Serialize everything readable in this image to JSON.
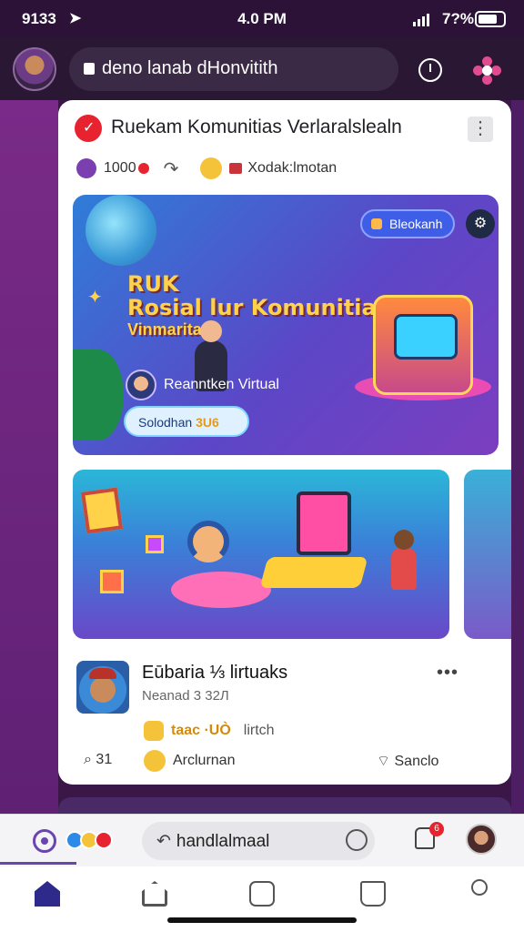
{
  "status_bar": {
    "time": "9133",
    "center_time": "4.0 PM",
    "battery": "7?%"
  },
  "browser": {
    "url": "deno lanab dHonvitith"
  },
  "card": {
    "title": "Ruekam Komunitias Verlaralslealn",
    "meta_count": "1000",
    "meta_label": "Xodak:lmotan",
    "hero": {
      "pill_label": "Bleokanh",
      "title_line1": "RUK",
      "title_line2": "Rosial lur Komunitias",
      "title_line3": "Vinmaritan",
      "badge_label": "Reanntken Virtual",
      "cta_prefix": "Solodhan ",
      "cta_accent": "3U6"
    },
    "post": {
      "title": "Eūbaria ⅓ lirtuaks",
      "subtitle": "Neanad 3 32Л",
      "tag_yellow": "taac ·UÒ",
      "tag_grey": "lirtch",
      "comments": "31",
      "reaction_label": "Arclurnan",
      "share_label": "Sanclo"
    }
  },
  "input_bar": {
    "placeholder_value": "handlalmaal",
    "notification_badge": "6"
  },
  "colors": {
    "accent": "#6a44b0",
    "badge_red": "#e6232e",
    "nav_active": "#2d2a8c"
  },
  "icons": [
    "location-arrow-icon",
    "lock-icon",
    "compass-icon",
    "flower-icon",
    "check-icon",
    "share-icon",
    "more-icon",
    "comment-icon",
    "chat-icon",
    "bell-icon",
    "home-icon",
    "add-icon",
    "activity-icon",
    "library-icon",
    "profile-icon"
  ]
}
